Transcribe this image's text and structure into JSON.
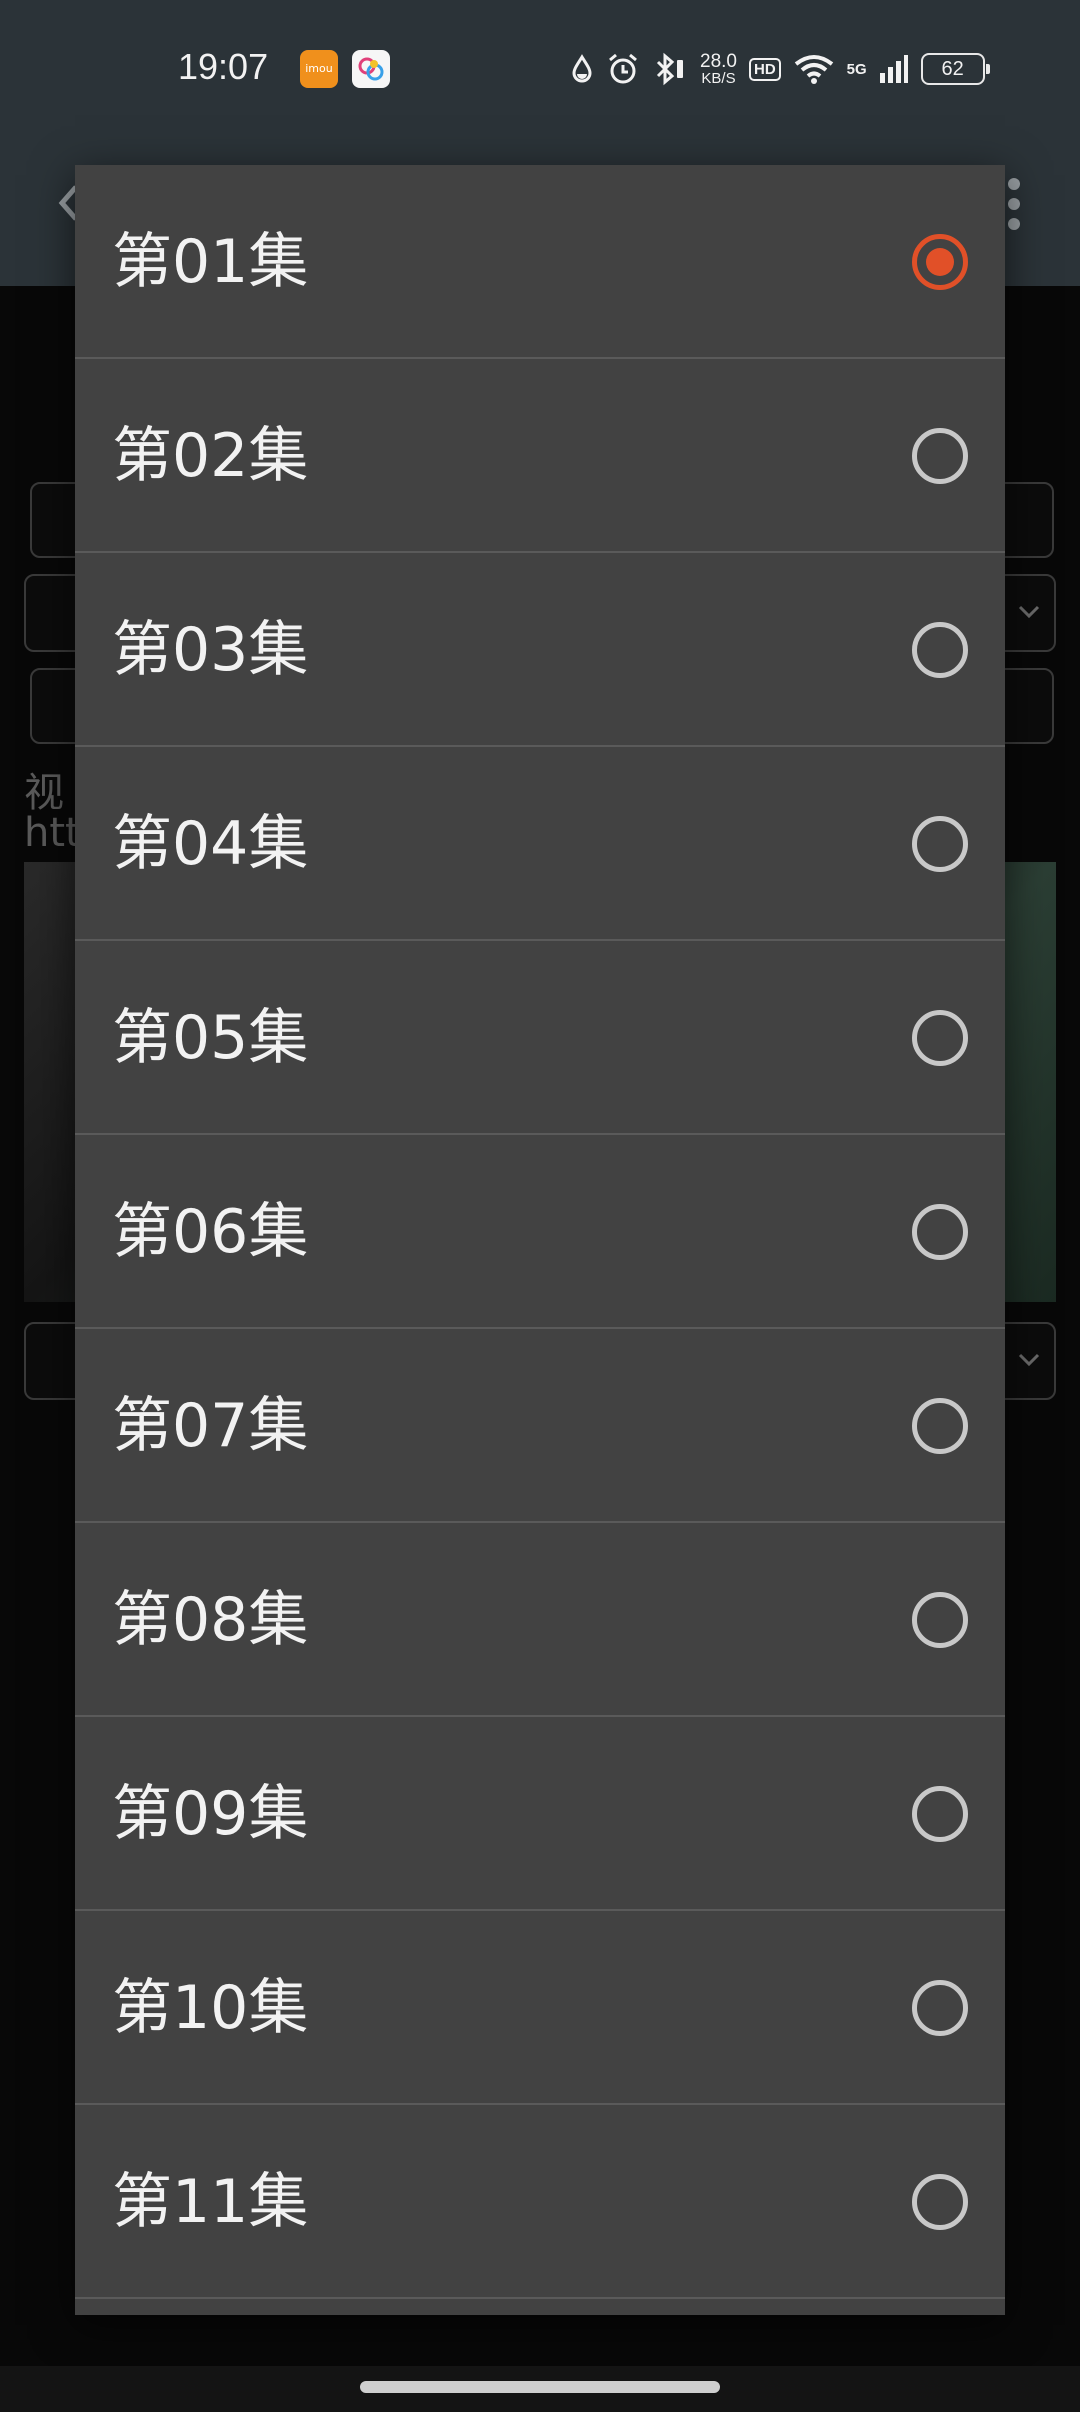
{
  "status_bar": {
    "time": "19:07",
    "app1_icon": "imou-app-icon",
    "app1_label": "imou",
    "app2_icon": "colorful-app-icon",
    "net_speed_value": "28.0",
    "net_speed_unit": "KB/S",
    "hd_label": "HD",
    "network_label": "5G",
    "battery": "62"
  },
  "background": {
    "label_text_1": "视",
    "label_text_2": "htt"
  },
  "dialog": {
    "items": [
      {
        "label": "第01集",
        "checked": true
      },
      {
        "label": "第02集",
        "checked": false
      },
      {
        "label": "第03集",
        "checked": false
      },
      {
        "label": "第04集",
        "checked": false
      },
      {
        "label": "第05集",
        "checked": false
      },
      {
        "label": "第06集",
        "checked": false
      },
      {
        "label": "第07集",
        "checked": false
      },
      {
        "label": "第08集",
        "checked": false
      },
      {
        "label": "第09集",
        "checked": false
      },
      {
        "label": "第10集",
        "checked": false
      },
      {
        "label": "第11集",
        "checked": false
      }
    ]
  },
  "colors": {
    "accent": "#e15028",
    "dialog_bg": "#424242",
    "status_bar_bg": "#2b3338"
  }
}
